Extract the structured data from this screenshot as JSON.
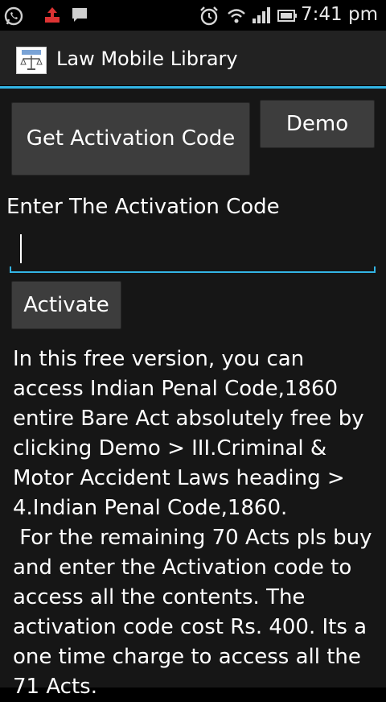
{
  "status_bar": {
    "time": "7:41 pm",
    "left_icons": [
      "whatsapp-icon",
      "upload-icon",
      "message-icon"
    ],
    "right_icons": [
      "alarm-icon",
      "wifi-icon",
      "signal-icon",
      "battery-icon"
    ]
  },
  "action_bar": {
    "title": "Law Mobile Library"
  },
  "buttons": {
    "get_activation_code": "Get Activation Code",
    "demo": "Demo",
    "activate": "Activate"
  },
  "activation": {
    "label": "Enter The Activation Code",
    "value": ""
  },
  "info_text": "In this free version, you can access Indian Penal Code,1860 entire Bare Act absolutely free by clicking Demo > III.Criminal & Motor Accident Laws heading > 4.Indian Penal Code,1860.\n For the remaining 70 Acts pls buy and enter the Activation code to access all the contents. The activation code cost Rs. 400. Its a one time charge to access all the 71 Acts."
}
